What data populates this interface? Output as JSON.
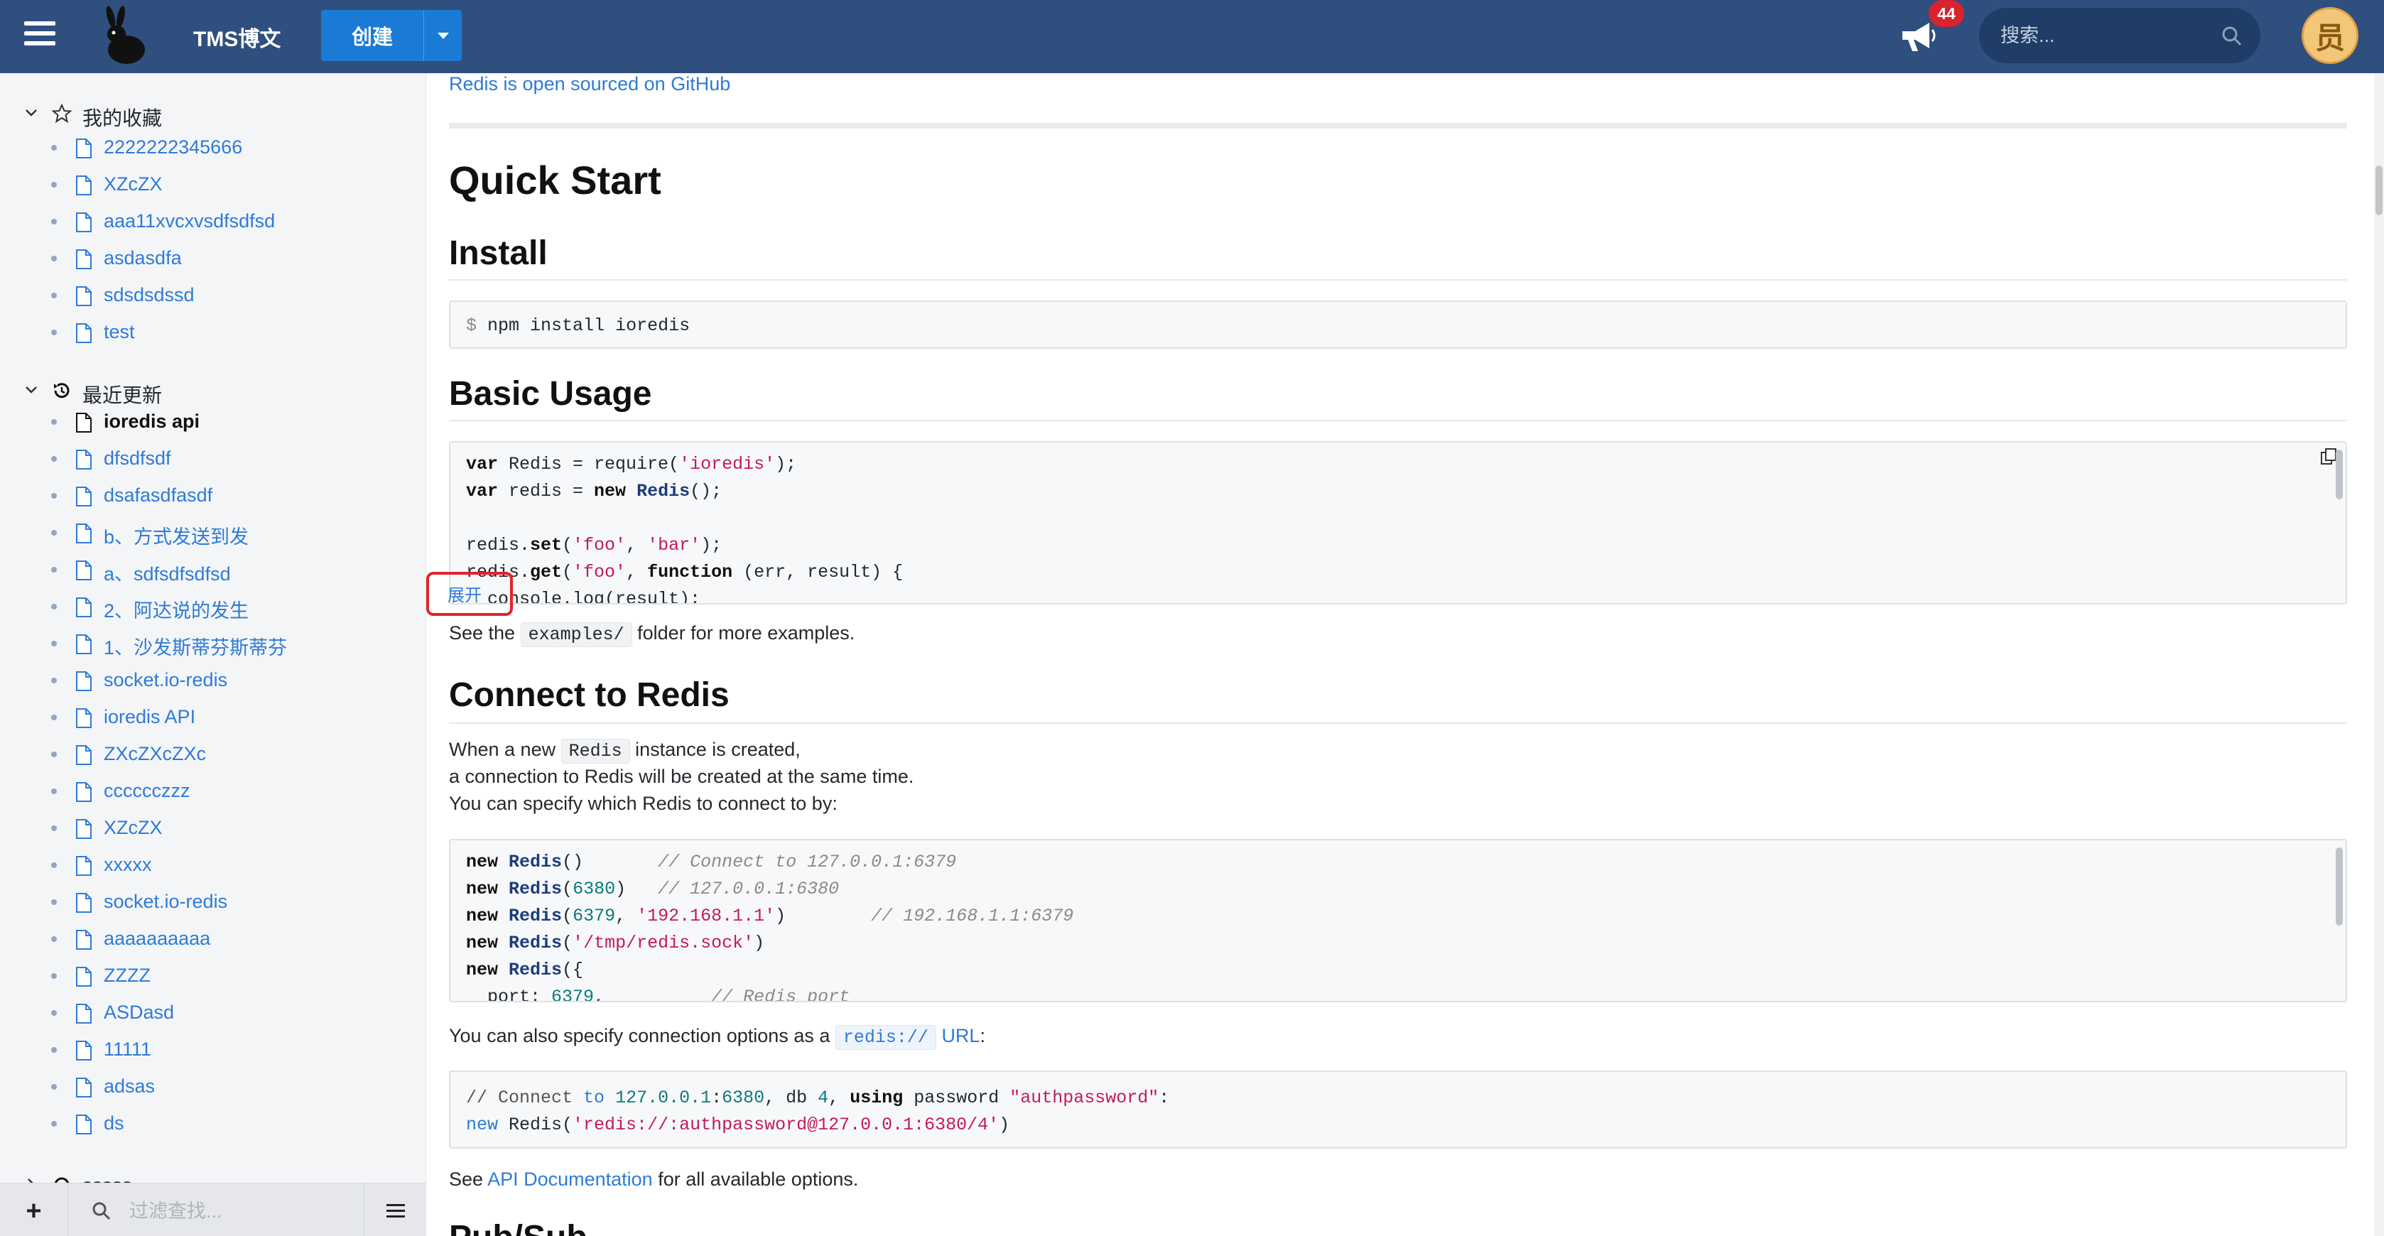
{
  "header": {
    "brand": "TMS博文",
    "create_label": "创建",
    "notification_count": "44",
    "search_placeholder": "搜索...",
    "avatar_text": "员"
  },
  "sidebar": {
    "favorites": {
      "title": "我的收藏",
      "items": [
        "2222222345666",
        "XZcZX",
        "aaa11xvcxvsdfsdfsd",
        "asdasdfa",
        "sdsdsdssd",
        "test"
      ]
    },
    "recent": {
      "title": "最近更新",
      "items": [
        "ioredis api",
        "dfsdfsdf",
        "dsafasdfasdf",
        "b、方式发送到发",
        "a、sdfsdfsdfsd",
        "2、阿达说的发生",
        "1、沙发斯蒂芬斯蒂芬",
        "socket.io-redis",
        "ioredis API",
        "ZXcZXcZXc",
        "cccccczzz",
        "XZcZX",
        "xxxxx",
        "socket.io-redis",
        "aaaaaaaaaa",
        "ZZZZ",
        "ASDasd",
        "11111",
        "adsas",
        "ds"
      ]
    },
    "third_section_title": "sssss",
    "filter_placeholder": "过滤查找..."
  },
  "content": {
    "github_link": "Redis is open sourced on GitHub",
    "quick_start": "Quick Start",
    "install": "Install",
    "install_cmd_prompt": "$",
    "install_cmd": "npm install ioredis",
    "basic_usage": "Basic Usage",
    "expand_label": "展开",
    "see_the": "See the",
    "examples_code": "examples/",
    "examples_suffix": "folder for more examples.",
    "connect_title": "Connect to Redis",
    "connect_p1_a": "When a new",
    "connect_p1_code": "Redis",
    "connect_p1_b": "instance is created,",
    "connect_p2": "a connection to Redis will be created at the same time.",
    "connect_p3": "You can specify which Redis to connect to by:",
    "url_p_a": "You can also specify connection options as a",
    "url_p_code": "redis://",
    "url_p_link": "URL",
    "url_p_colon": ":",
    "see": "See",
    "api_link": "API Documentation",
    "api_suffix": "for all available options.",
    "next_heading": "Pub/Sub"
  }
}
